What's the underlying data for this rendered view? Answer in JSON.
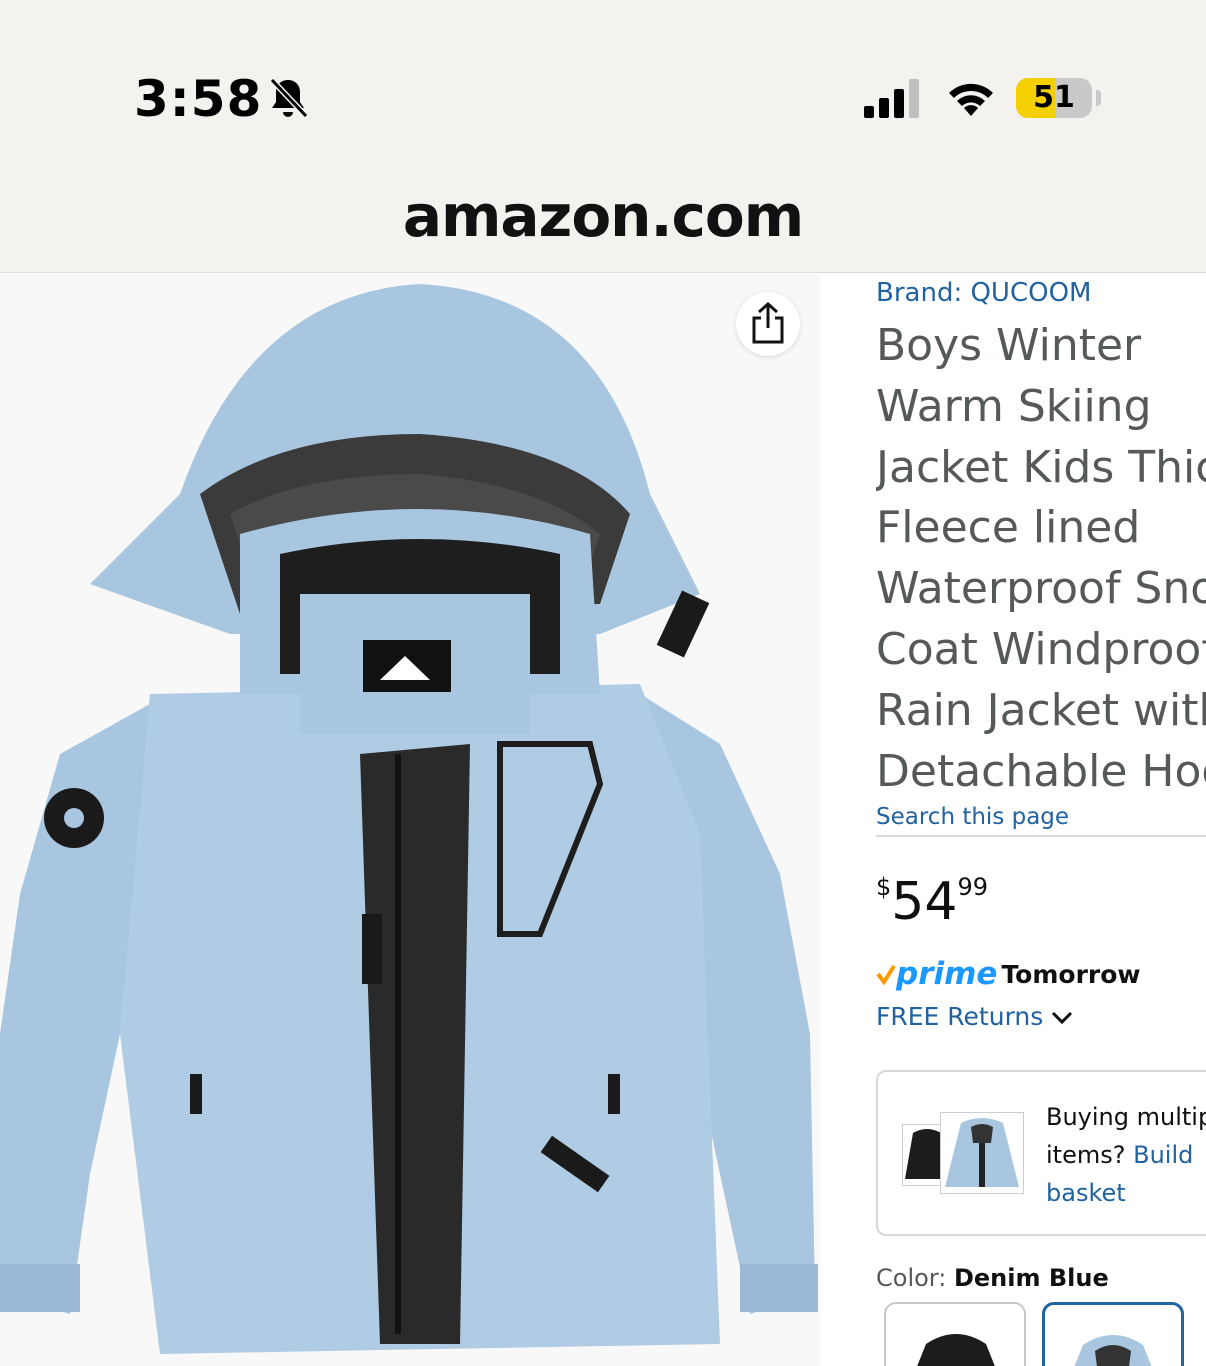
{
  "status_bar": {
    "time": "3:58",
    "battery_level": "51",
    "battery_fraction": 0.51,
    "icons": [
      "bell-slash-icon",
      "cellular-signal-icon",
      "wifi-icon",
      "battery-icon"
    ]
  },
  "browser": {
    "url": "amazon.com"
  },
  "product": {
    "brand_link": "Brand: QUCOOM",
    "title_lines": [
      "Boys Winter",
      "Warm Skiing",
      "Jacket Kids Thick",
      "Fleece lined",
      "Waterproof Snow",
      "Coat Windproof",
      "Rain Jacket with",
      "Detachable Hood"
    ],
    "search_link": "Search this page",
    "price": {
      "symbol": "$",
      "whole": "54",
      "fraction": "99"
    },
    "prime_word": "prime",
    "delivery": "Tomorrow",
    "returns_link": "FREE Returns",
    "bundle": {
      "text_1": "Buying multiple",
      "text_2": "items?",
      "link_1": "Build",
      "link_2": "basket"
    },
    "color_label": "Color:",
    "color_value": "Denim Blue",
    "swatches": [
      "Black",
      "Denim Blue"
    ]
  },
  "colors": {
    "link": "#2162a1",
    "prime_blue": "#1a98ff",
    "prime_check": "#ff9900",
    "jacket": "#a9c6e1",
    "battery_fill": "#f5d000"
  }
}
